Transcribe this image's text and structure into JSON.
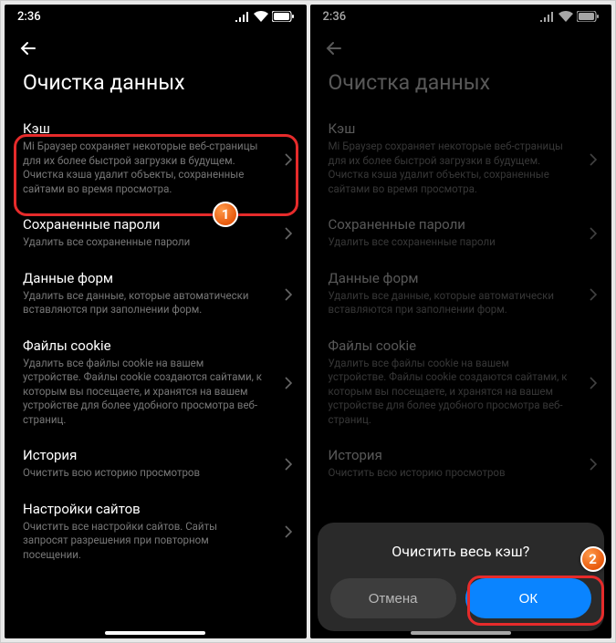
{
  "status": {
    "time": "2:36"
  },
  "titlebar": {
    "page_title": "Очистка данных"
  },
  "items": [
    {
      "title": "Кэш",
      "desc": "Mi Браузер сохраняет некоторые веб-страницы для их более быстрой загрузки в будущем. Очистка кэша удалит объекты, сохраненные сайтами во время просмотра."
    },
    {
      "title": "Сохраненные пароли",
      "desc": "Удалить все сохраненные пароли"
    },
    {
      "title": "Данные форм",
      "desc": "Удалить все данные, которые автоматически вставляются при заполнении форм."
    },
    {
      "title": "Файлы cookie",
      "desc": "Удалить все файлы cookie на вашем устройстве. Файлы cookie создаются сайтами, к которым вы посещаете, и хранятся на вашем устройстве для более удобного просмотра веб-страниц."
    },
    {
      "title": "История",
      "desc": "Очистить всю историю просмотров"
    },
    {
      "title": "Настройки сайтов",
      "desc": "Очистить все настройки сайтов. Сайты запросят разрешения при повторном посещении."
    }
  ],
  "dialog": {
    "title": "Очистить весь кэш?",
    "cancel": "Отмена",
    "ok": "ОК"
  },
  "badges": {
    "one": "1",
    "two": "2"
  }
}
